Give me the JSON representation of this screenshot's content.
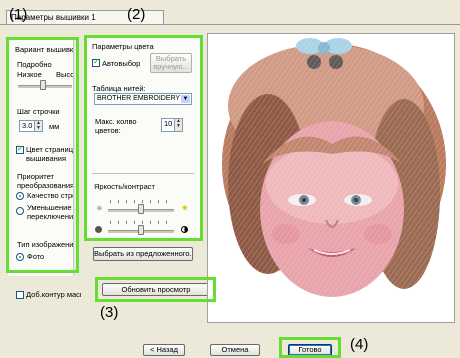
{
  "tab": {
    "label": "Параметры вышивки 1"
  },
  "annotations": {
    "a1": "(1)",
    "a2": "(2)",
    "a3": "(3)",
    "a4": "(4)"
  },
  "left_panel": {
    "variant_label": "Вариант вышивки",
    "detail_label": "Подробно",
    "low_label": "Низкое",
    "high_label": "Высокое",
    "stitch_step_label": "Шаг строчки",
    "stitch_step_value": "3.0",
    "stitch_step_unit": "мм",
    "color_page_label_1": "Цвет страницы",
    "color_page_label_2": "вышивания",
    "priority_label_1": "Приоритет",
    "priority_label_2": "преобразования",
    "quality_label": "Качество строчки",
    "reduce_label_1": "Уменьшение",
    "reduce_label_2": "переключений",
    "image_type_label": "Тип изображения",
    "photo_label": "Фото",
    "outline_label": "Доб.контур маски"
  },
  "color_panel": {
    "title": "Параметры цвета",
    "auto_select_label": "Автовыбор",
    "select_manual_label": "Выбрать вручную...",
    "thread_table_label": "Таблица нитей:",
    "thread_table_value": "BROTHER EMBROIDERY",
    "max_colors_label_1": "Макс. колво",
    "max_colors_label_2": "цветов:",
    "max_colors_value": "10",
    "brightness_label": "Яркость/контраст"
  },
  "buttons": {
    "choose_suggested": "Выбрать из предложенного...",
    "refresh_preview": "Обновить просмотр",
    "back": "< Назад",
    "cancel": "Отмена",
    "done": "Готово"
  },
  "colors": {
    "highlight": "#66dd33",
    "selection": "#316ac5"
  }
}
